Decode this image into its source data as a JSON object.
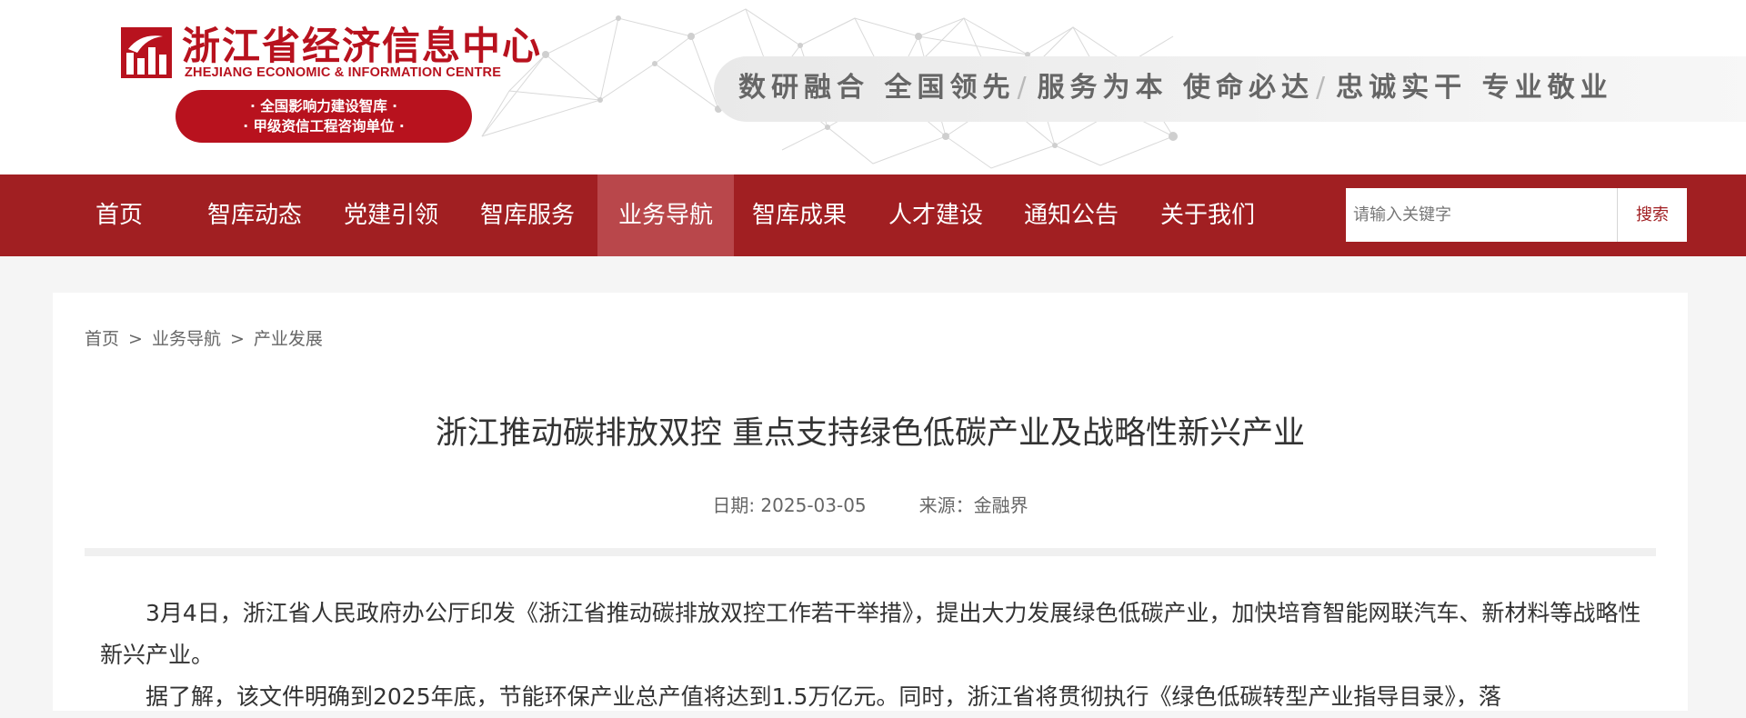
{
  "header": {
    "logo_cn": "浙江省经济信息中心",
    "logo_en": "ZHEJIANG ECONOMIC & INFORMATION CENTRE",
    "badge_line1": "· 全国影响力建设智库 ·",
    "badge_line2": "· 甲级资信工程咨询单位 ·",
    "slogans": [
      "数研融合 全国领先",
      "服务为本 使命必达",
      "忠诚实干 专业敬业"
    ],
    "slogan_sep": "/"
  },
  "nav": {
    "items": [
      "首页",
      "智库动态",
      "党建引领",
      "智库服务",
      "业务导航",
      "智库成果",
      "人才建设",
      "通知公告",
      "关于我们"
    ],
    "active": "业务导航"
  },
  "search": {
    "placeholder": "请输入关键字",
    "button": "搜索"
  },
  "breadcrumb": {
    "items": [
      "首页",
      "业务导航",
      "产业发展"
    ],
    "sep": ">"
  },
  "article": {
    "title": "浙江推动碳排放双控 重点支持绿色低碳产业及战略性新兴产业",
    "date": "日期: 2025-03-05",
    "source": "来源：金融界",
    "paragraphs": [
      "3月4日，浙江省人民政府办公厅印发《浙江省推动碳排放双控工作若干举措》，提出大力发展绿色低碳产业，加快培育智能网联汽车、新材料等战略性新兴产业。",
      "据了解，该文件明确到2025年底，节能环保产业总产值将达到1.5万亿元。同时，浙江省将贯彻执行《绿色低碳转型产业指导目录》，落"
    ]
  },
  "colors": {
    "brand_red": "#b8121e",
    "nav_bg": "#a11f22",
    "nav_active": "#b9474b",
    "page_bg": "#f5f5f5"
  },
  "icons": {
    "logo": "zjeic-logo-icon"
  }
}
